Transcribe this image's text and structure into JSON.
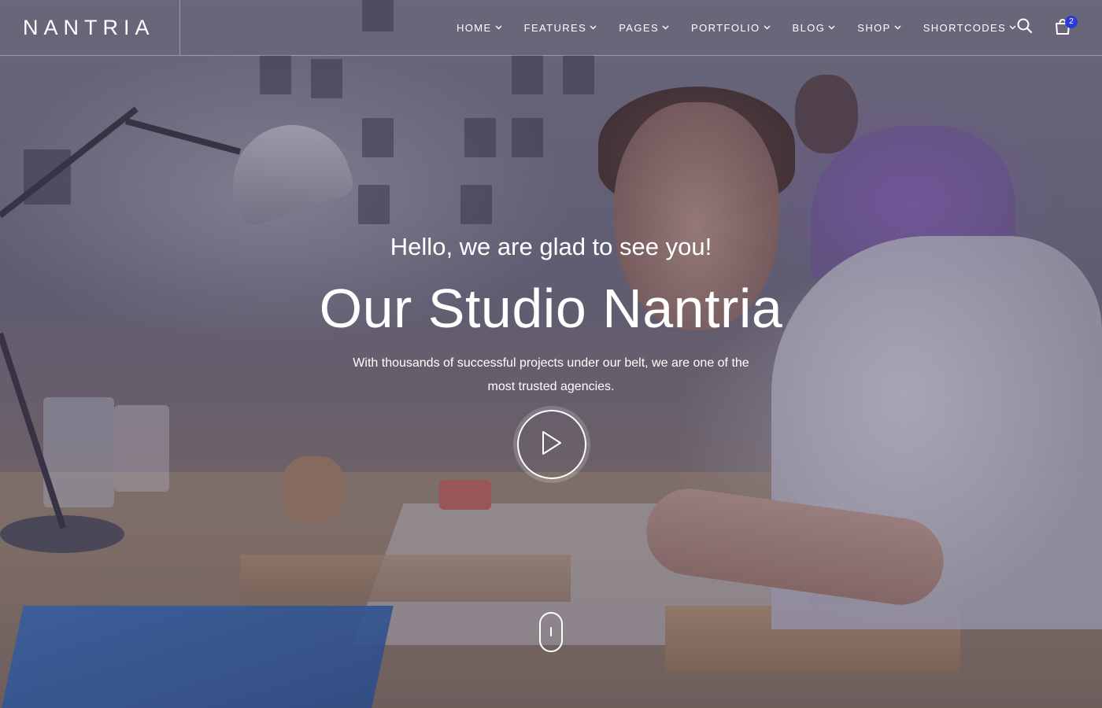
{
  "header": {
    "logo": "NANTRIA",
    "nav": [
      {
        "label": "HOME"
      },
      {
        "label": "FEATURES"
      },
      {
        "label": "PAGES"
      },
      {
        "label": "PORTFOLIO"
      },
      {
        "label": "BLOG"
      },
      {
        "label": "SHOP"
      },
      {
        "label": "SHORTCODES"
      }
    ],
    "icons": {
      "search": "search-icon",
      "cart": "shopping-bag-icon"
    },
    "cart_count": "2"
  },
  "hero": {
    "greeting": "Hello, we are glad to see you!",
    "title": "Our Studio Nantria",
    "subtitle": "With thousands of successful projects under our belt, we are one of the most trusted agencies.",
    "play_icon": "play-icon",
    "scroll_icon": "mouse-scroll-icon"
  },
  "colors": {
    "badge": "#2d3bd6",
    "text": "#ffffff"
  }
}
